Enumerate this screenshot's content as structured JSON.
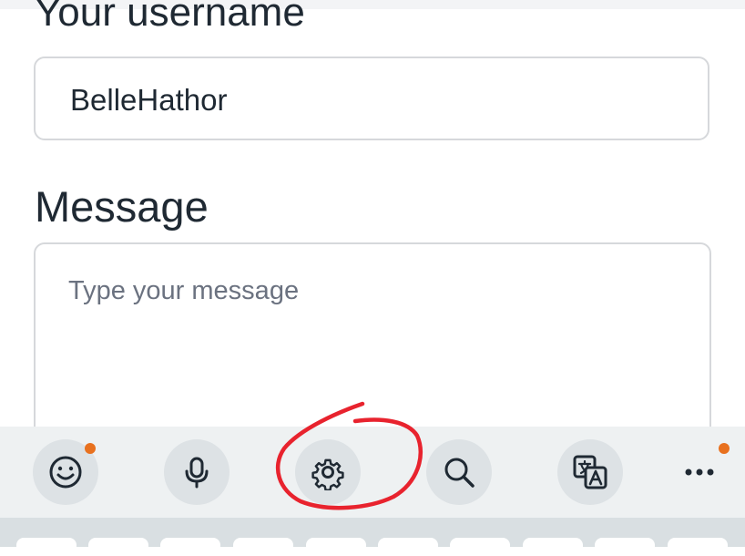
{
  "form": {
    "username_label": "Your username",
    "username_value": "BelleHathor",
    "message_label": "Message",
    "message_placeholder": "Type your message"
  },
  "keyboard_toolbar": {
    "tools": [
      {
        "name": "emoji",
        "icon": "smiley-icon",
        "badge": true
      },
      {
        "name": "voice-input",
        "icon": "microphone-icon",
        "badge": false
      },
      {
        "name": "settings",
        "icon": "gear-icon",
        "badge": false,
        "highlighted_by_annotation": true
      },
      {
        "name": "search",
        "icon": "search-icon",
        "badge": false
      },
      {
        "name": "translate",
        "icon": "translate-icon",
        "badge": false
      },
      {
        "name": "more",
        "icon": "more-horizontal-icon",
        "badge": true
      }
    ],
    "badge_color": "#e8711f"
  },
  "annotation": {
    "type": "hand-drawn circle",
    "color": "#e8232e",
    "target": "settings"
  }
}
